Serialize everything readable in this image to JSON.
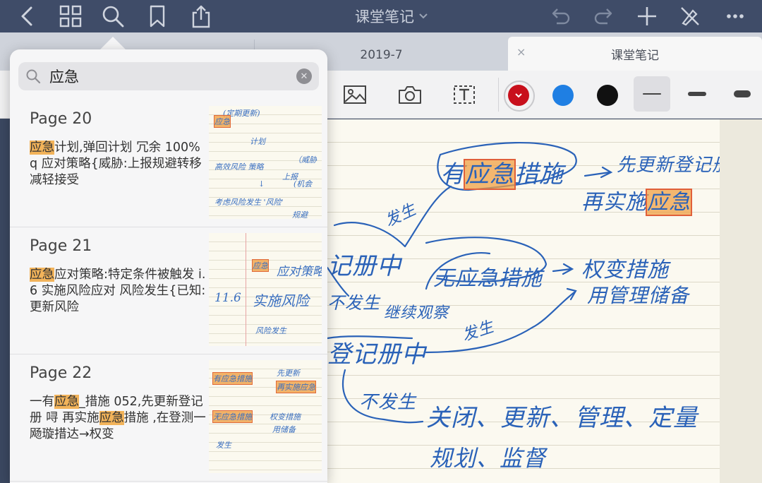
{
  "topbar": {
    "title": "课堂笔记",
    "icons": [
      "back-icon",
      "grid-icon",
      "search-icon",
      "bookmark-icon",
      "share-icon",
      "undo-icon",
      "redo-icon",
      "add-icon",
      "tools-off-icon",
      "more-icon"
    ]
  },
  "tabs": [
    {
      "label": "2019-7",
      "active": false
    },
    {
      "label": "课堂笔记",
      "active": true,
      "close": "×"
    }
  ],
  "toolbar": {
    "colors": [
      "#c8101c",
      "#1f7fe3",
      "#111111"
    ],
    "selected_color": "#c8101c",
    "strokes": [
      "thin",
      "medium",
      "thick"
    ],
    "selected_stroke": "thin"
  },
  "search": {
    "query": "应急",
    "clear": "✕"
  },
  "results": [
    {
      "page": "Page 20",
      "snippet": [
        [
          "应急",
          true
        ],
        [
          "计划,弹回计划 冗余 100% q 应对策略{威胁:上报规避转移减轻接受",
          false
        ]
      ],
      "thumb": [
        "(定期更新)",
        "应急",
        "计划",
        "高效风险 策略",
        "（威胁",
        "↓",
        "上报",
        "(机会",
        "考虑风险发生 '风险'",
        "规避"
      ]
    },
    {
      "page": "Page 21",
      "snippet": [
        [
          "应急",
          true
        ],
        [
          "应对策略:特定条件被触发 i. 6 实施风险应对 风险发生{已知: 更新风险",
          false
        ]
      ],
      "thumb": [
        "应急",
        "应对策略",
        "11.6",
        "实施风险",
        "风险发生"
      ]
    },
    {
      "page": "Page 22",
      "snippet": [
        [
          "一有",
          false
        ],
        [
          "应急",
          true
        ],
        [
          "_措施 052,先更新登记册 㖊 再实施",
          false
        ],
        [
          "应急",
          true
        ],
        [
          "措施 ,在登测一飏璇措达→权变",
          false
        ]
      ],
      "thumb": [
        "有应急措施",
        "先更新",
        "再实施应急",
        "无应急措施",
        "权变措施",
        "用储备",
        "发生"
      ]
    }
  ],
  "notes": {
    "line1": "有",
    "line1_hl": "应急",
    "line1_end": "措施",
    "arrow_right1": "先更新登记册",
    "line2_pre": "再实施",
    "line2_hl": "应急",
    "fasheng1": "发生",
    "dengjice1": "记册中",
    "wu_yingji": "无应急措施",
    "quanbian": "权变措施",
    "yong_chubei": "用管理储备",
    "bu_fasheng": "不发生",
    "jixu_guancha": "继续观察",
    "fasheng2": "发生",
    "dengjice2": "登记册中",
    "bufasheng2": "不发生",
    "actions": "关闭、更新、管理、定量",
    "actions2": "规划、监督"
  }
}
